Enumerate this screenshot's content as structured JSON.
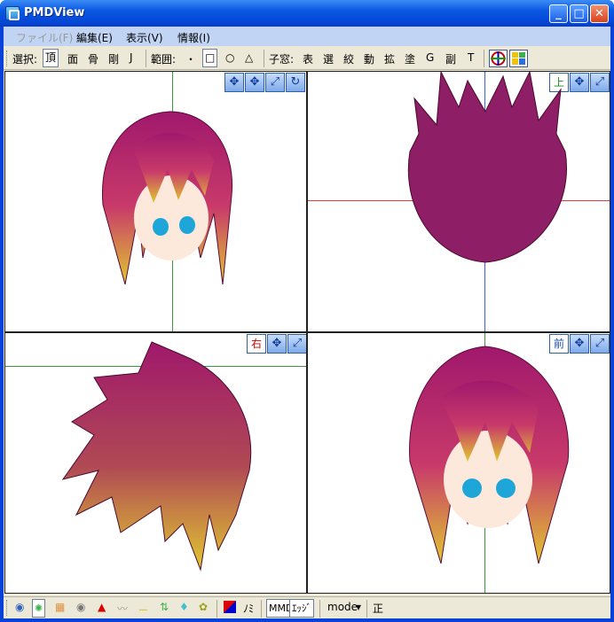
{
  "window": {
    "title": "PMDView"
  },
  "menu": [
    {
      "label": "ファイル(F)",
      "enabled": false
    },
    {
      "label": "編集(E)",
      "enabled": true
    },
    {
      "label": "表示(V)",
      "enabled": true
    },
    {
      "label": "情報(I)",
      "enabled": true
    }
  ],
  "toolbar": {
    "select_label": "選択:",
    "select_items": [
      "頂",
      "面",
      "骨",
      "剛",
      "J"
    ],
    "range_label": "範囲:",
    "range_items": [
      "・",
      "□",
      "○",
      "△"
    ],
    "subwin_label": "子窓:",
    "subwin_items": [
      "表",
      "選",
      "絞",
      "動",
      "拡",
      "塗",
      "G",
      "副",
      "T"
    ]
  },
  "views": {
    "top_label": "上",
    "right_label": "右",
    "front_label": "前"
  },
  "statusbar": {
    "mmd_label": "MMD",
    "edge_label": "ｴｯｼﾞ",
    "mode_label": "mode",
    "mode_arrow": "▾",
    "sei_label": "正",
    "nomi_label": "ﾉﾐ"
  },
  "colors": {
    "hair_top": "#a0186c",
    "hair_bottom": "#e0c830",
    "axis_green": "#3a9a3a",
    "axis_blue": "#4060d8",
    "axis_red": "#d84040"
  }
}
